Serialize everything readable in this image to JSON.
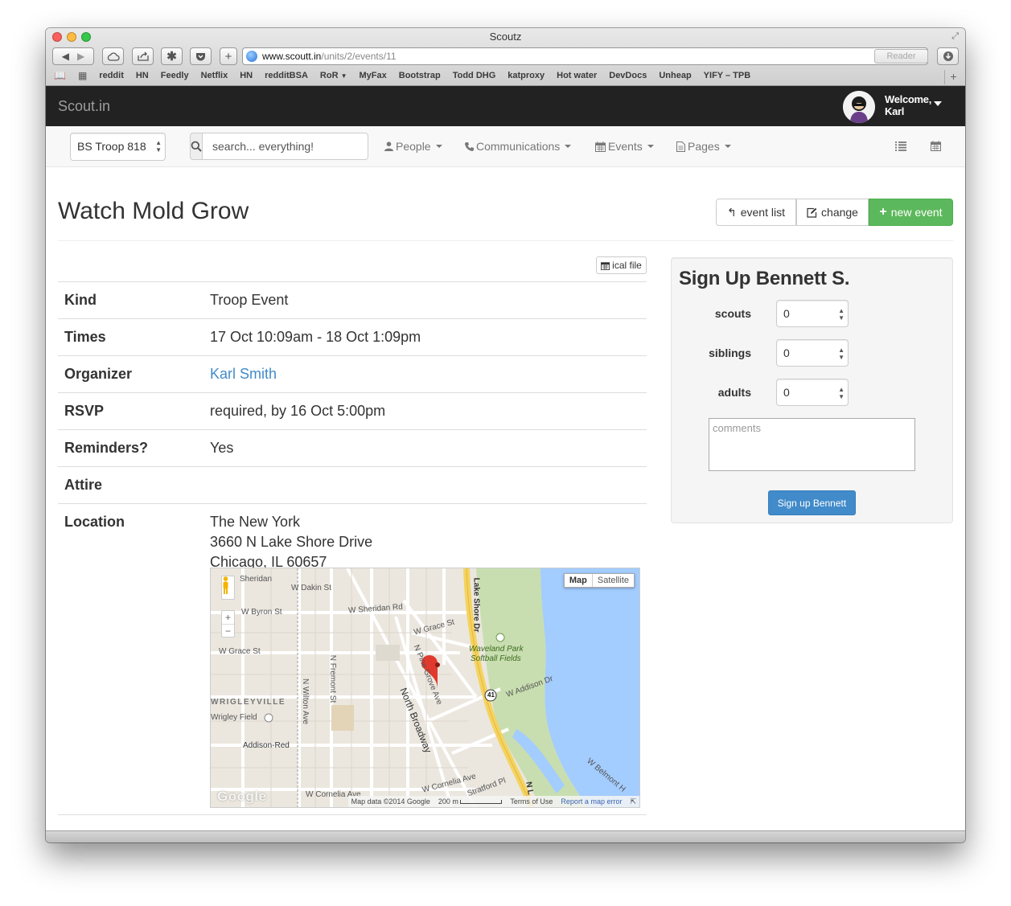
{
  "window": {
    "title": "Scoutz"
  },
  "browser": {
    "url_host": "www.scoutt.in",
    "url_path": "/units/2/events/11",
    "reader_label": "Reader",
    "bookmarks": [
      "reddit",
      "HN",
      "Feedly",
      "Netflix",
      "HN",
      "redditBSA",
      "RoR",
      "MyFax",
      "Bootstrap",
      "Todd DHG",
      "katproxy",
      "Hot water",
      "DevDocs",
      "Unheap",
      "YIFY – TPB"
    ]
  },
  "topbar": {
    "brand": "Scout.in",
    "welcome": "Welcome,",
    "user": "Karl"
  },
  "subnav": {
    "troop": "BS Troop 818",
    "search_placeholder": "search... everything!",
    "menus": {
      "people": "People",
      "communications": "Communications",
      "events": "Events",
      "pages": "Pages"
    }
  },
  "page": {
    "title": "Watch Mold Grow",
    "buttons": {
      "event_list": "event list",
      "change": "change",
      "new_event": "new event"
    },
    "ical": "ical file"
  },
  "details": {
    "kind_label": "Kind",
    "kind": "Troop Event",
    "times_label": "Times",
    "times": "17 Oct 10:09am - 18 Oct 1:09pm",
    "organizer_label": "Organizer",
    "organizer": "Karl Smith",
    "rsvp_label": "RSVP",
    "rsvp": "required, by 16 Oct 5:00pm",
    "reminders_label": "Reminders?",
    "reminders": "Yes",
    "attire_label": "Attire",
    "attire": "",
    "location_label": "Location",
    "location_line1": "The New York",
    "location_line2": "3660 N Lake Shore Drive",
    "location_line3": "Chicago, IL 60657"
  },
  "map": {
    "type_map": "Map",
    "type_satellite": "Satellite",
    "footer_data": "Map data ©2014 Google",
    "footer_scale": "200 m",
    "footer_terms": "Terms of Use",
    "footer_report": "Report a map error",
    "logo": "Google",
    "labels": {
      "sheridan": "Sheridan",
      "w_dakin": "W Dakin St",
      "w_byron": "W Byron St",
      "w_sheridan_rd": "W Sheridan Rd",
      "w_grace": "W Grace St",
      "w_grace2": "W Grace St",
      "lake_shore": "Lake Shore Dr",
      "waveland": "Waveland Park",
      "softball": "Softball Fields",
      "n_pine_grove": "N Pine Grove Ave",
      "n_fremont": "N Fremont St",
      "n_wilton": "N Wilton Ave",
      "north_broadway": "North Broadway",
      "w_addison": "W Addison Dr",
      "wrigleyville": "WRIGLEYVILLE",
      "wrigley_field": "Wrigley Field",
      "addison_red": "Addison-Red",
      "w_cornelia": "W Cornelia Ave",
      "w_cornelia2": "W Cornelia Ave",
      "stratford": "Stratford Pl",
      "w_belmont": "W Belmont H",
      "route": "41",
      "nl": "N L"
    }
  },
  "signup": {
    "title": "Sign Up Bennett S.",
    "scouts_label": "scouts",
    "scouts": "0",
    "siblings_label": "siblings",
    "siblings": "0",
    "adults_label": "adults",
    "adults": "0",
    "comments_placeholder": "comments",
    "button": "Sign up Bennett"
  },
  "colors": {
    "success": "#5cb85c",
    "primary": "#428bca",
    "navbar": "#222222",
    "link": "#428bca"
  }
}
